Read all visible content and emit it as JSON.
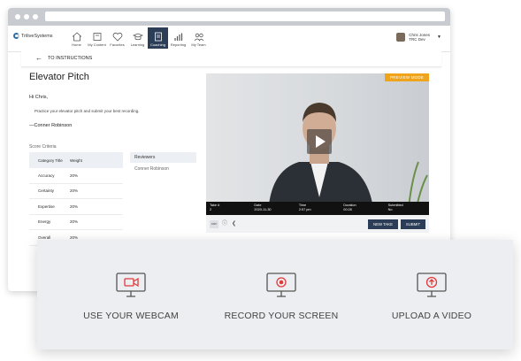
{
  "app": {
    "logo_text": "TriliveSystems",
    "nav": [
      {
        "label": "Home",
        "icon": "home-icon"
      },
      {
        "label": "My Content",
        "icon": "content-icon"
      },
      {
        "label": "Favorites",
        "icon": "heart-icon"
      },
      {
        "label": "Learning",
        "icon": "graduation-cap-icon"
      },
      {
        "label": "Coaching",
        "icon": "coaching-icon",
        "active": true
      },
      {
        "label": "Reporting",
        "icon": "bar-chart-icon"
      },
      {
        "label": "My Team",
        "icon": "team-icon"
      }
    ],
    "user": {
      "name": "Chris Jones",
      "org": "TRC Dev"
    }
  },
  "subnav": {
    "back_label": "TO INSTRUCTIONS"
  },
  "content": {
    "title": "Elevator Pitch",
    "greeting": "Hi Chris,",
    "instructions": "Practice your elevator pitch and submit your best recording.",
    "signature": "—Conner Robinson"
  },
  "score_criteria": {
    "label": "Score Criteria",
    "headers": [
      "Category Title",
      "Weight"
    ],
    "rows": [
      [
        "Accuracy",
        "20%"
      ],
      [
        "Certainty",
        "20%"
      ],
      [
        "Expertise",
        "20%"
      ],
      [
        "Energy",
        "20%"
      ],
      [
        "Overall",
        "20%"
      ]
    ]
  },
  "reviewers": {
    "header": "Reviewers",
    "names": [
      "Conner Robinson"
    ]
  },
  "video": {
    "badge": "PREVIEW MODE",
    "info": [
      {
        "label": "Take #",
        "value": "2"
      },
      {
        "label": "Date",
        "value": "2020-11-30"
      },
      {
        "label": "Time",
        "value": "2:57 pm"
      },
      {
        "label": "Duration",
        "value": "00:28"
      },
      {
        "label": "Submitted",
        "value": "No"
      }
    ],
    "cam_label": "cam",
    "new_take_label": "NEW TAKE",
    "submit_label": "SUBMIT"
  },
  "options": [
    {
      "label": "USE YOUR WEBCAM",
      "icon": "webcam-monitor-icon"
    },
    {
      "label": "RECORD YOUR SCREEN",
      "icon": "record-screen-monitor-icon"
    },
    {
      "label": "UPLOAD A VIDEO",
      "icon": "upload-video-monitor-icon"
    }
  ],
  "colors": {
    "accent_red": "#e03a3a",
    "nav_active": "#2c3e57",
    "badge": "#f0a41c"
  }
}
